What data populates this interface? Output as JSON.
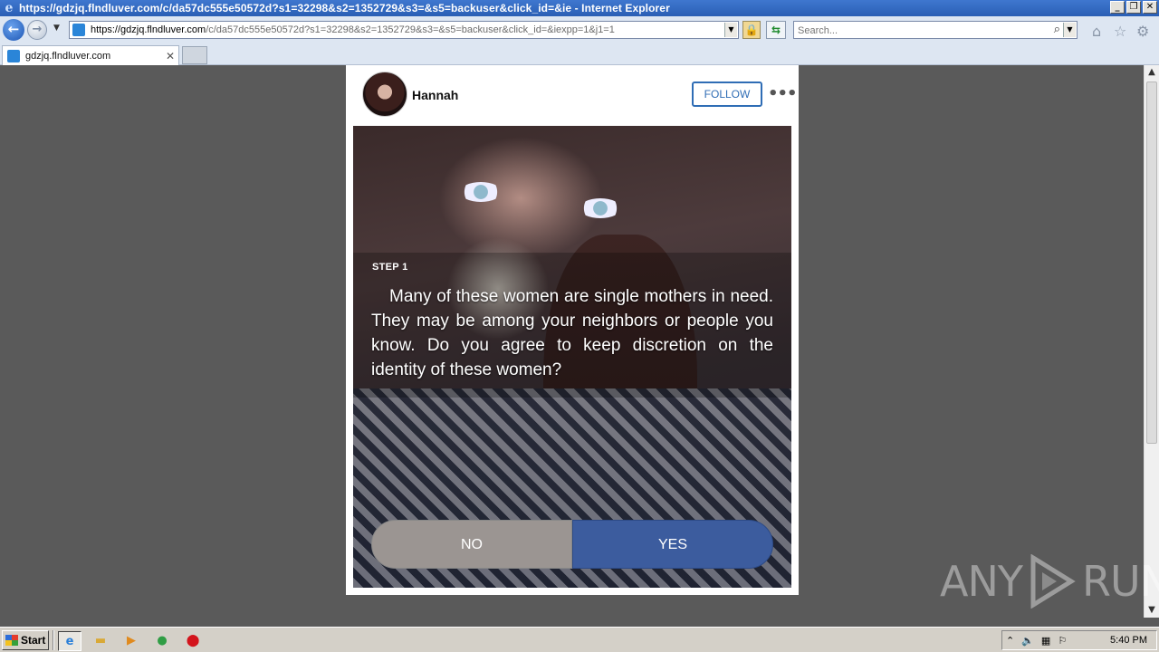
{
  "window": {
    "title": "https://gdzjq.flndluver.com/c/da57dc555e50572d?s1=32298&s2=1352729&s3=&s5=backuser&click_id=&ie - Internet Explorer"
  },
  "address_bar": {
    "url_host": "https://gdzjq.flndluver.com",
    "url_path": "/c/da57dc555e50572d?s1=32298&s2=1352729&s3=&s5=backuser&click_id=&iexpp=1&j1=1",
    "search_placeholder": "Search..."
  },
  "tab": {
    "title": "gdzjq.flndluver.com"
  },
  "post": {
    "username": "Hannah",
    "follow_label": "FOLLOW",
    "more_label": "•••",
    "step_label": "STEP 1",
    "question": "Many of these women are single mothers in need. They may be among your neighbors or people you know. Do you agree to keep discretion on the identity of these women?",
    "no_label": "NO",
    "yes_label": "YES"
  },
  "watermark": {
    "left": "ANY",
    "right": "RUN"
  },
  "taskbar": {
    "start_label": "Start",
    "clock": "5:40 PM"
  },
  "colors": {
    "yes_button": "#3c5c9e",
    "no_button": "#9b9592",
    "follow_accent": "#2f6db5",
    "page_background": "#5a5a5a"
  }
}
